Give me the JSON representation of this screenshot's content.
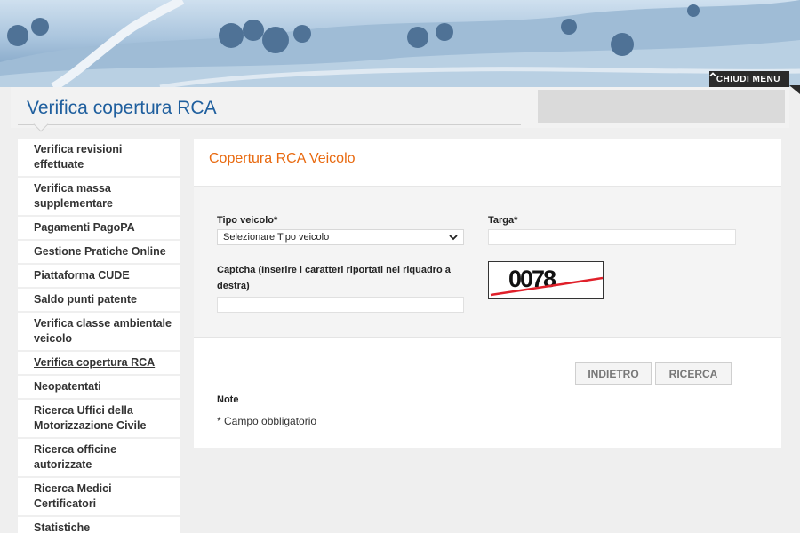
{
  "header": {
    "close_menu_label": "CHIUDI MENU",
    "page_title": "Verifica copertura RCA"
  },
  "sidebar": {
    "items": [
      {
        "label": "Verifica revisioni effettuate",
        "active": false
      },
      {
        "label": "Verifica massa supplementare",
        "active": false
      },
      {
        "label": "Pagamenti PagoPA",
        "active": false
      },
      {
        "label": "Gestione Pratiche Online",
        "active": false
      },
      {
        "label": "Piattaforma CUDE",
        "active": false
      },
      {
        "label": "Saldo punti patente",
        "active": false
      },
      {
        "label": "Verifica classe ambientale veicolo",
        "active": false
      },
      {
        "label": "Verifica copertura RCA",
        "active": true
      },
      {
        "label": "Neopatentati",
        "active": false
      },
      {
        "label": "Ricerca Uffici della Motorizzazione Civile",
        "active": false
      },
      {
        "label": "Ricerca officine autorizzate",
        "active": false
      },
      {
        "label": "Ricerca Medici Certificatori",
        "active": false
      },
      {
        "label": "Statistiche immatricolazioni",
        "active": false
      }
    ]
  },
  "form": {
    "title": "Copertura RCA Veicolo",
    "tipo_veicolo_label": "Tipo veicolo*",
    "tipo_veicolo_selected": "Selezionare Tipo veicolo",
    "targa_label": "Targa*",
    "targa_value": "",
    "captcha_label": "Captcha (Inserire i caratteri riportati nel riquadro a destra)",
    "captcha_value": "",
    "captcha_image_text": "0078",
    "back_button": "INDIETRO",
    "search_button": "RICERCA",
    "note_title": "Note",
    "note_text": "* Campo obbligatorio"
  },
  "colors": {
    "title_blue": "#1f5f9e",
    "form_title_orange": "#e8690f",
    "captcha_strike_red": "#e0202a"
  }
}
